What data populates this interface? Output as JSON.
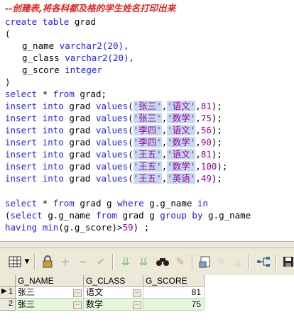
{
  "editor": {
    "comment": "--创建表,将各科都及格的学生姓名打印出来",
    "create_kw": "create table",
    "create_name": "grad",
    "open_paren": "(",
    "col1_name": "g_name",
    "col1_type": "varchar2(20),",
    "col2_name": "g_class",
    "col2_type": "varchar2(20),",
    "col3_name": "g_score",
    "col3_type": "integer",
    "close_paren": ")",
    "select1_a": "select",
    "select1_b": "* ",
    "select1_c": "from",
    "select1_d": " grad;",
    "inserts": [
      {
        "name": "'张三'",
        "cls": "'语文'",
        "score": "81"
      },
      {
        "name": "'张三'",
        "cls": "'数学'",
        "score": "75"
      },
      {
        "name": "'李四'",
        "cls": "'语文'",
        "score": "56"
      },
      {
        "name": "'李四'",
        "cls": "'数学'",
        "score": "90"
      },
      {
        "name": "'王五'",
        "cls": "'语文'",
        "score": "81"
      },
      {
        "name": "'王五'",
        "cls": "'数学'",
        "score": "100"
      },
      {
        "name": "'王五'",
        "cls": "'英语'",
        "score": "49"
      }
    ],
    "insert_kw": "insert into",
    "insert_tbl": " grad ",
    "values_kw": "values",
    "q1": "select * from grad g where g.g_name in",
    "q2": "(select g.g_name from grad g group by g.g_name",
    "q3": "having min(g.g_score)>59) ;"
  },
  "grid": {
    "headers": [
      "G_NAME",
      "G_CLASS",
      "G_SCORE"
    ],
    "rows": [
      {
        "num": "1",
        "name": "张三",
        "cls": "语文",
        "score": "81"
      },
      {
        "num": "2",
        "name": "张三",
        "cls": "数学",
        "score": "75"
      }
    ],
    "dots": "..."
  },
  "toolbar": {
    "icons": [
      "grid-icon",
      "lock-icon",
      "add-icon",
      "remove-icon",
      "post-icon",
      "expand-icon",
      "collapse-icon",
      "find-icon",
      "clear-icon",
      "query-icon",
      "down-icon",
      "up-icon",
      "link-icon",
      "save-icon"
    ]
  }
}
